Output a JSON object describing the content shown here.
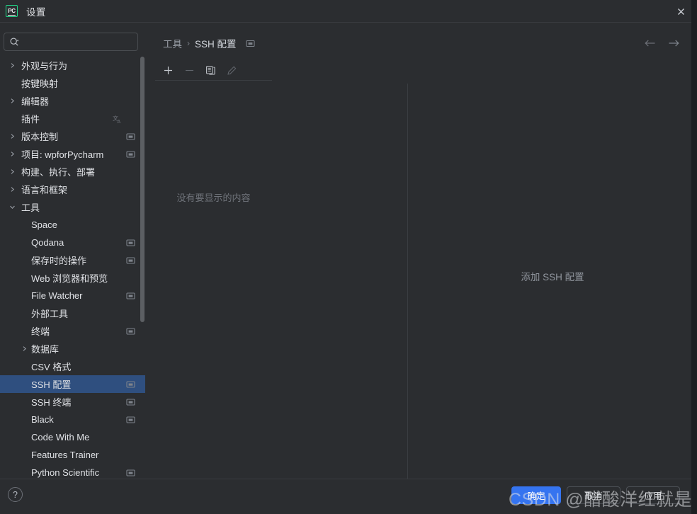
{
  "window": {
    "title": "设置",
    "logo_text": "PC",
    "close_icon": "close-icon"
  },
  "search": {
    "value": "",
    "placeholder": "",
    "icon": "search-icon"
  },
  "sidebar": {
    "items": [
      {
        "label": "外观与行为",
        "indent": 0,
        "arrow": "chevron-right",
        "badge": "",
        "selected": false
      },
      {
        "label": "按键映射",
        "indent": 0,
        "arrow": "",
        "badge": "",
        "selected": false
      },
      {
        "label": "编辑器",
        "indent": 0,
        "arrow": "chevron-right",
        "badge": "",
        "selected": false
      },
      {
        "label": "插件",
        "indent": 0,
        "arrow": "",
        "badge": "translate",
        "selected": false
      },
      {
        "label": "版本控制",
        "indent": 0,
        "arrow": "chevron-right",
        "badge": "monitor",
        "selected": false
      },
      {
        "label": "项目: wpforPycharm",
        "indent": 0,
        "arrow": "chevron-right",
        "badge": "monitor",
        "selected": false
      },
      {
        "label": "构建、执行、部署",
        "indent": 0,
        "arrow": "chevron-right",
        "badge": "",
        "selected": false
      },
      {
        "label": "语言和框架",
        "indent": 0,
        "arrow": "chevron-right",
        "badge": "",
        "selected": false
      },
      {
        "label": "工具",
        "indent": 0,
        "arrow": "chevron-down",
        "badge": "",
        "selected": false
      },
      {
        "label": "Space",
        "indent": 1,
        "arrow": "",
        "badge": "",
        "selected": false
      },
      {
        "label": "Qodana",
        "indent": 1,
        "arrow": "",
        "badge": "monitor",
        "selected": false
      },
      {
        "label": "保存时的操作",
        "indent": 1,
        "arrow": "",
        "badge": "monitor",
        "selected": false
      },
      {
        "label": "Web 浏览器和预览",
        "indent": 1,
        "arrow": "",
        "badge": "",
        "selected": false
      },
      {
        "label": "File Watcher",
        "indent": 1,
        "arrow": "",
        "badge": "monitor",
        "selected": false
      },
      {
        "label": "外部工具",
        "indent": 1,
        "arrow": "",
        "badge": "",
        "selected": false
      },
      {
        "label": "终端",
        "indent": 1,
        "arrow": "",
        "badge": "monitor",
        "selected": false
      },
      {
        "label": "数据库",
        "indent": 1,
        "arrow": "chevron-right",
        "badge": "",
        "selected": false
      },
      {
        "label": "CSV 格式",
        "indent": 1,
        "arrow": "",
        "badge": "",
        "selected": false
      },
      {
        "label": "SSH 配置",
        "indent": 1,
        "arrow": "",
        "badge": "monitor",
        "selected": true
      },
      {
        "label": "SSH 终端",
        "indent": 1,
        "arrow": "",
        "badge": "monitor",
        "selected": false
      },
      {
        "label": "Black",
        "indent": 1,
        "arrow": "",
        "badge": "monitor",
        "selected": false
      },
      {
        "label": "Code With Me",
        "indent": 1,
        "arrow": "",
        "badge": "",
        "selected": false
      },
      {
        "label": "Features Trainer",
        "indent": 1,
        "arrow": "",
        "badge": "",
        "selected": false
      },
      {
        "label": "Python Scientific",
        "indent": 1,
        "arrow": "",
        "badge": "monitor",
        "selected": false
      }
    ]
  },
  "content": {
    "breadcrumb": {
      "parent": "工具",
      "separator": "›",
      "current": "SSH 配置",
      "badge_icon": "monitor-icon"
    },
    "nav": {
      "back_icon": "arrow-left-icon",
      "forward_icon": "arrow-right-icon"
    },
    "list_toolbar": {
      "add_icon": "plus-icon",
      "remove_icon": "minus-icon",
      "copy_icon": "copy-icon",
      "edit_icon": "pencil-icon"
    },
    "list_empty_text": "没有要显示的内容",
    "detail_empty_text": "添加 SSH 配置"
  },
  "footer": {
    "help_label": "?",
    "ok_label": "确定",
    "cancel_label": "取消",
    "apply_label": "应用"
  },
  "watermark": {
    "text": "CSDN @醋酸洋红就是我"
  },
  "colors": {
    "background": "#2b2d30",
    "selection": "#2f4f7f",
    "primary_button": "#3574f0",
    "text": "#dfe1e5",
    "muted_text": "#8f949c",
    "accent_logo": "#21d789"
  }
}
